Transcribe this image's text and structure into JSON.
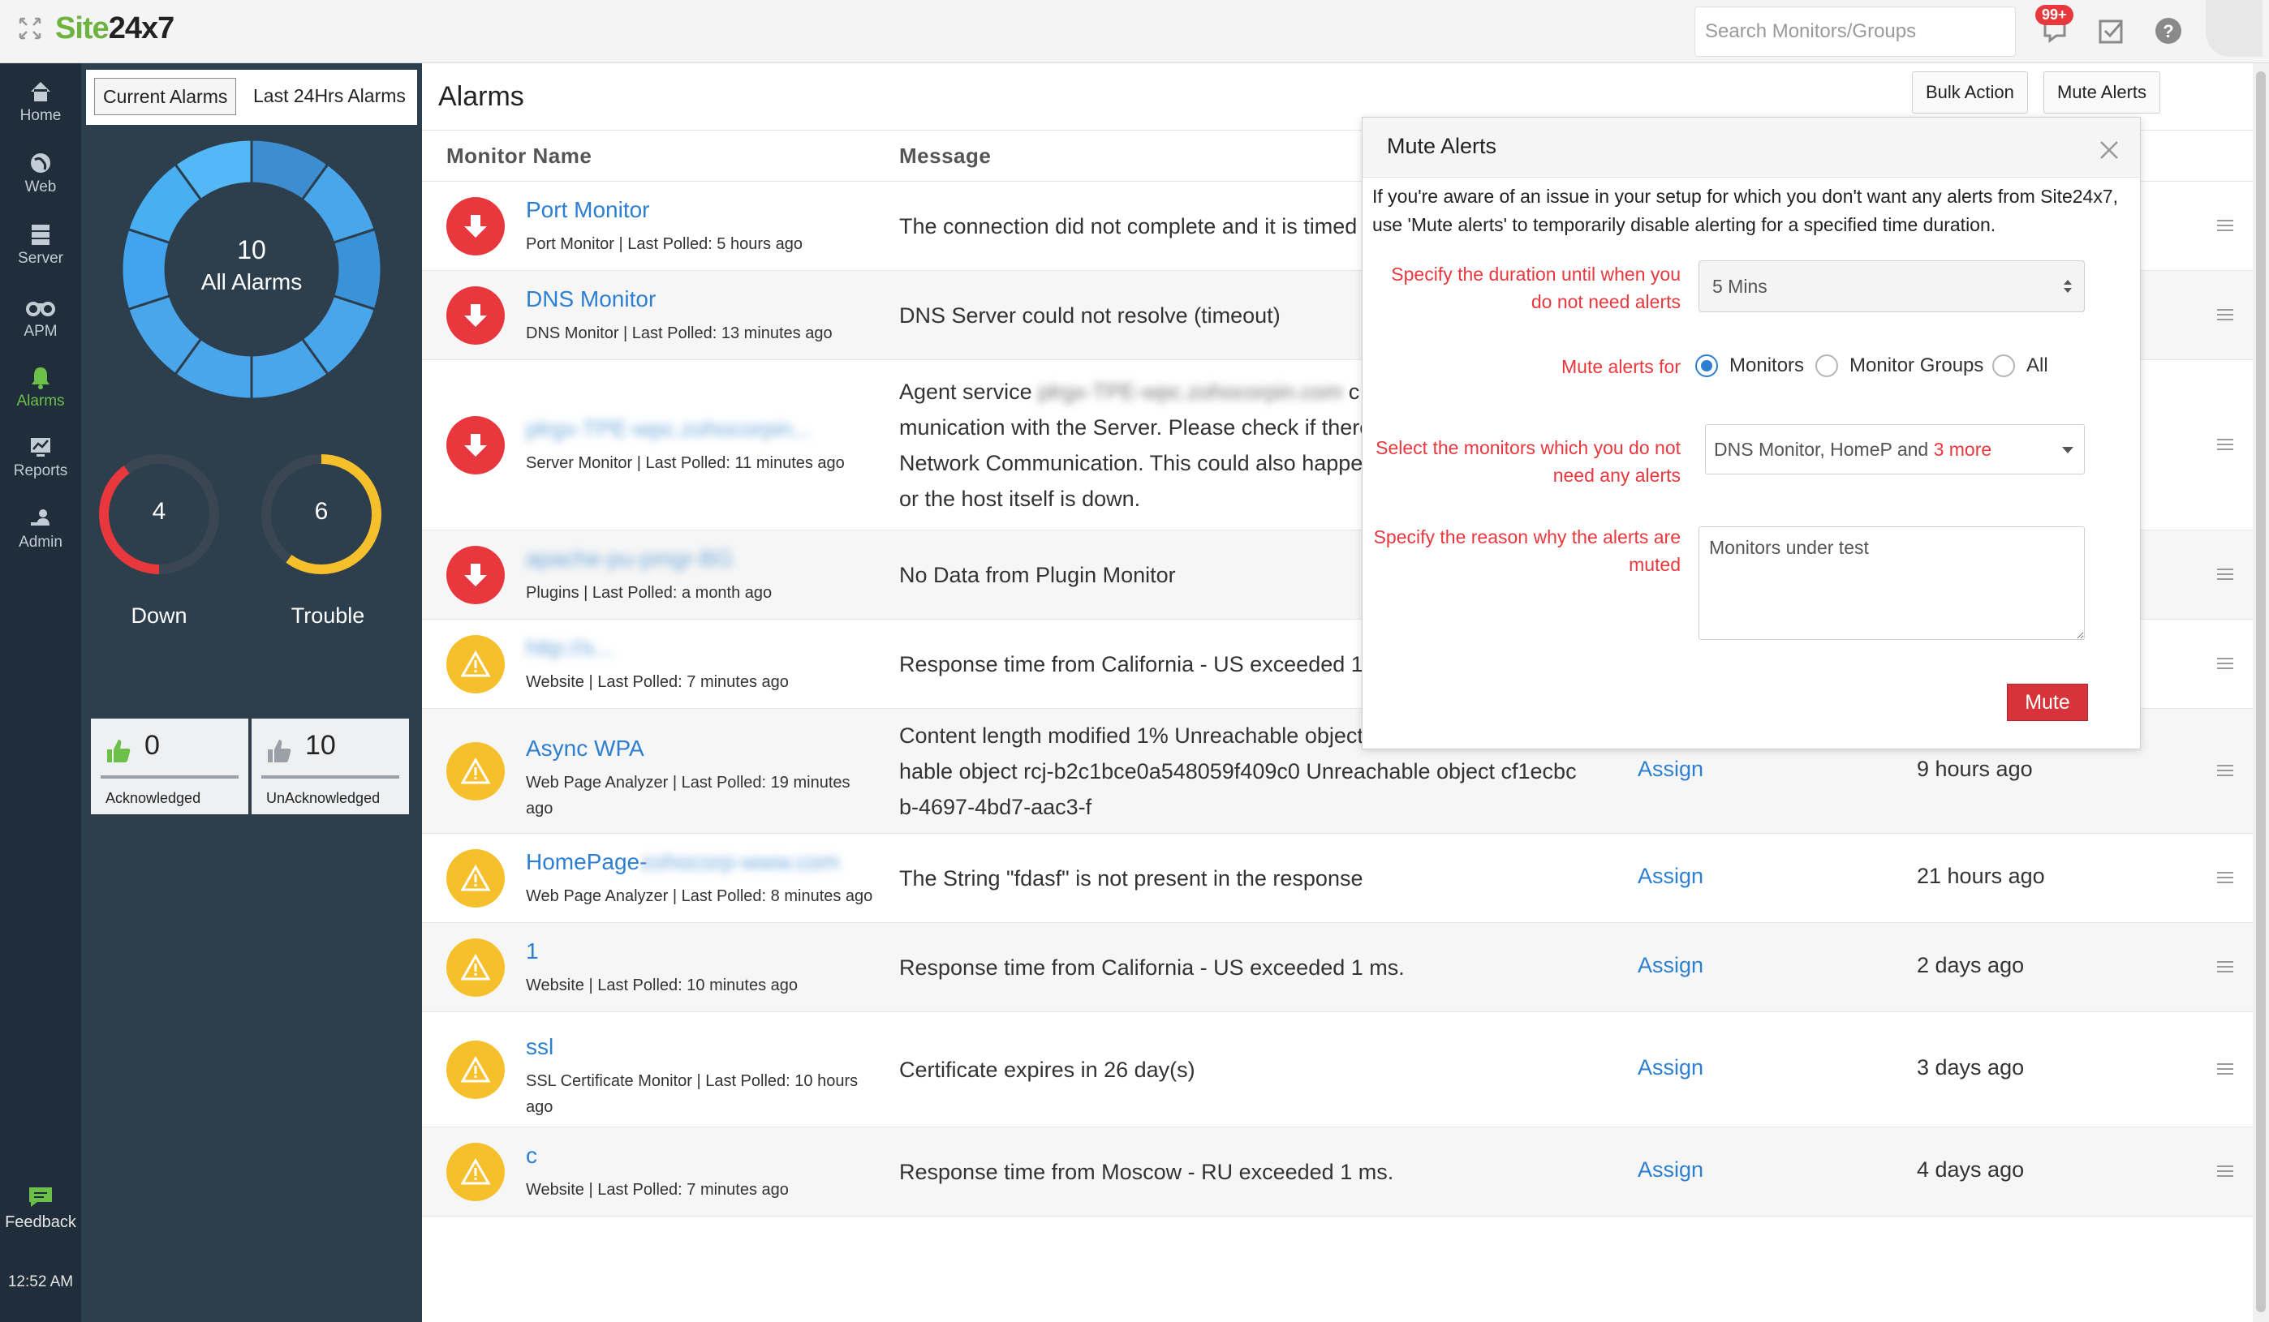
{
  "app": {
    "logo_prefix": "Site",
    "logo_suffix": "24x7",
    "search_placeholder": "Search Monitors/Groups",
    "notification_badge": "99+"
  },
  "nav": {
    "items": [
      {
        "label": "Home",
        "icon": "home-icon"
      },
      {
        "label": "Web",
        "icon": "globe-icon"
      },
      {
        "label": "Server",
        "icon": "server-icon"
      },
      {
        "label": "APM",
        "icon": "binoculars-icon"
      },
      {
        "label": "Alarms",
        "icon": "bell-icon",
        "active": true
      },
      {
        "label": "Reports",
        "icon": "chart-icon"
      },
      {
        "label": "Admin",
        "icon": "admin-icon"
      }
    ],
    "feedback": "Feedback",
    "time": "12:52 AM"
  },
  "summary": {
    "tabs": [
      "Current Alarms",
      "Last 24Hrs Alarms"
    ],
    "total": "10",
    "total_label": "All Alarms",
    "down_count": "4",
    "down_label": "Down",
    "trouble_count": "6",
    "trouble_label": "Trouble",
    "ack_count": "0",
    "ack_label": "Acknowledged",
    "unack_count": "10",
    "unack_label": "UnAcknowledged",
    "down_fraction": 0.4,
    "trouble_fraction": 0.6
  },
  "main": {
    "title": "Alarms",
    "bulk_action": "Bulk Action",
    "mute_alerts": "Mute Alerts",
    "col_monitor": "Monitor Name",
    "col_message": "Message",
    "assign": "Assign",
    "rows": [
      {
        "status": "down",
        "name": "Port Monitor",
        "sub": "Port Monitor | Last Polled: 5 hours ago",
        "message": "The connection did not complete and it is timed",
        "when": ""
      },
      {
        "status": "down",
        "name": "DNS Monitor",
        "sub": "DNS Monitor | Last Polled: 13 minutes ago",
        "message": "DNS Server could not resolve (timeout)",
        "when": ""
      },
      {
        "status": "down",
        "name": "plrgx-TPE-wpc.zohocorpin...",
        "sub": "Server Monitor | Last Polled: 11 minutes ago",
        "message": "Agent service",
        "message_blur": "plrgx-TPE-wpc.zohocorpin.com",
        "message_cont": "c",
        "message_lines": [
          "munication with the Server. Please check if there",
          "Network Communication. This could also happen",
          "or the host itself is down."
        ],
        "when": ""
      },
      {
        "status": "down",
        "name": "apache-pu-pmgr-BG",
        "sub": "Plugins | Last Polled: a month ago",
        "message": "No Data from Plugin Monitor",
        "when": ""
      },
      {
        "status": "trouble",
        "name": "http://s...",
        "sub": "Website | Last Polled: 7 minutes ago",
        "message": "Response time from California - US exceeded 1",
        "when": ""
      },
      {
        "status": "trouble",
        "name": "Async WPA",
        "sub": "Web Page Analyzer | Last Polled: 19 minutes ago",
        "message": "Content length modified 1% Unreachable object",
        "message_lines": [
          "hable object rcj-b2c1bce0a548059f409c0 Unreachable object cf1ecbc",
          "b-4697-4bd7-aac3-f"
        ],
        "when": "9 hours ago"
      },
      {
        "status": "trouble",
        "name": "HomePage-",
        "name_blur": "zohocorp-www.com",
        "sub": "Web Page Analyzer | Last Polled: 8 minutes ago",
        "message": "The String \"fdasf\" is not present in the response",
        "when": "21 hours ago"
      },
      {
        "status": "trouble",
        "name": "1",
        "sub": "Website | Last Polled: 10 minutes ago",
        "message": "Response time from California - US exceeded 1 ms.",
        "when": "2 days ago"
      },
      {
        "status": "trouble",
        "name": "ssl",
        "sub": "SSL Certificate Monitor | Last Polled: 10 hours ago",
        "message": "Certificate expires in 26 day(s)",
        "when": "3 days ago"
      },
      {
        "status": "trouble",
        "name": "c",
        "sub": "Website | Last Polled: 7 minutes ago",
        "message": "Response time from Moscow - RU exceeded 1 ms.",
        "when": "4 days ago"
      }
    ]
  },
  "modal": {
    "title": "Mute Alerts",
    "description": "If you're aware of an issue in your setup for which you don't want any alerts from Site24x7, use 'Mute alerts' to temporarily disable alerting for a specified time duration.",
    "duration_label": "Specify the duration until when you do not need alerts",
    "duration_value": "5 Mins",
    "mute_for_label": "Mute alerts for",
    "mute_for_options": [
      "Monitors",
      "Monitor Groups",
      "All"
    ],
    "monitors_label": "Select the monitors which you do not need any alerts",
    "monitors_value": "DNS Monitor, HomeP and",
    "monitors_more": "3 more",
    "reason_label": "Specify the reason why the alerts are muted",
    "reason_value": "Monitors under test",
    "mute_button": "Mute"
  },
  "colors": {
    "down": "#e8383d",
    "trouble": "#f6c02c",
    "link": "#2c7fd1",
    "brand_green": "#6cb33f",
    "donut_blue": "#42a4ee"
  }
}
